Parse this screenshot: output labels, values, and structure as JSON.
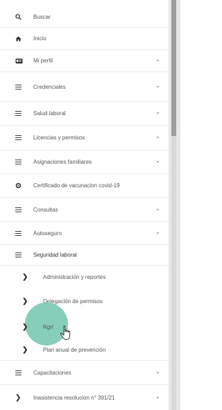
{
  "menu": {
    "items": [
      {
        "icon": "search-icon",
        "label": "Buscar",
        "arrow": ""
      },
      {
        "icon": "home-icon",
        "label": "Inicio",
        "arrow": ""
      },
      {
        "icon": "id-card-icon",
        "label": "Mi perfil",
        "arrow": "▾"
      },
      {
        "icon": "menu-lines-icon",
        "label": "Credenciales",
        "arrow": "▾"
      },
      {
        "icon": "menu-lines-icon",
        "label": "Salud laboral",
        "arrow": "▾"
      },
      {
        "icon": "menu-lines-icon",
        "label": "Licencias y permisos",
        "arrow": "▾"
      },
      {
        "icon": "menu-lines-icon",
        "label": "Asignaciones familiares",
        "arrow": "▾"
      },
      {
        "icon": "dot-icon",
        "label": "Certificado de vacunacion covid-19",
        "arrow": ""
      },
      {
        "icon": "menu-lines-icon",
        "label": "Consultas",
        "arrow": "▾"
      },
      {
        "icon": "menu-lines-icon",
        "label": "Autoseguro",
        "arrow": "▾"
      },
      {
        "icon": "menu-lines-icon",
        "label": "Seguridad laboral",
        "arrow": ""
      }
    ],
    "subitems": [
      {
        "label": "Administración y reportes"
      },
      {
        "label": "Delegación de permisos"
      },
      {
        "label": "Rgrl"
      },
      {
        "label": "Plan anual de prevención"
      }
    ],
    "after": [
      {
        "icon": "menu-lines-icon",
        "label": "Capacitaciones",
        "arrow": "▾"
      },
      {
        "icon": "chevron-right-icon",
        "label": "Inasistencia resolucion n° 391/21",
        "arrow": "▾"
      }
    ]
  },
  "colors": {
    "ripple": "#6cc3a8",
    "accent_strip": "#e7e7e7"
  }
}
